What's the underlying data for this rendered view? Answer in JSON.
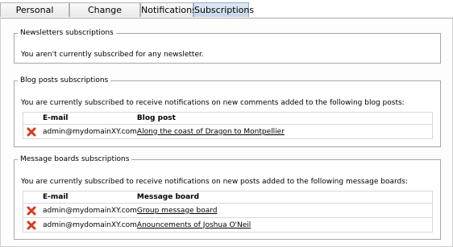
{
  "tabs": [
    {
      "label": "Personal settings",
      "active": false
    },
    {
      "label": "Change password",
      "active": false
    },
    {
      "label": "Notifications",
      "active": false
    },
    {
      "label": "Subscriptions",
      "active": true
    }
  ],
  "newsletters": {
    "legend": "Newsletters subscriptions",
    "message": "You aren't currently subscribed for any newsletter."
  },
  "blog": {
    "legend": "Blog posts subscriptions",
    "message": "You are currently subscribed to receive notifications on new comments added to the following blog posts:",
    "col_email": "E-mail",
    "col_item": "Blog post",
    "rows": [
      {
        "email": "admin@mydomainXY.com",
        "item": "Along the coast of Dragon to Montpellier"
      }
    ]
  },
  "boards": {
    "legend": "Message boards subscriptions",
    "message": "You are currently subscribed to receive notifications on new posts added to the following message boards:",
    "col_email": "E-mail",
    "col_item": "Message board",
    "rows": [
      {
        "email": "admin@mydomainXY.com",
        "item": "Group message board"
      },
      {
        "email": "admin@mydomainXY.com",
        "item": "Anouncements of Joshua O'Neil"
      }
    ]
  },
  "icons": {
    "delete": "delete-x-icon"
  },
  "colors": {
    "delete_icon": "#d83a1c",
    "active_tab": "#c6d6ea"
  }
}
